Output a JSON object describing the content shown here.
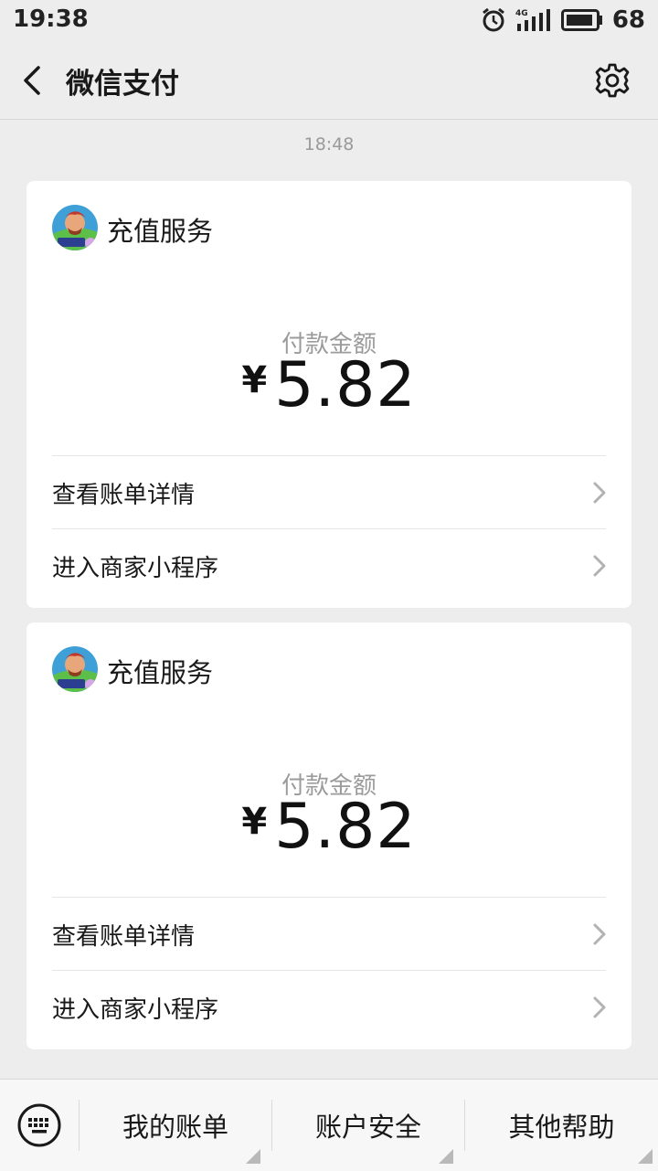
{
  "status_bar": {
    "time": "19:38",
    "network": "4G",
    "battery": "68"
  },
  "header": {
    "title": "微信支付"
  },
  "chat": {
    "timestamp": "18:48",
    "cards": [
      {
        "merchant": "充值服务",
        "amount_label": "付款金额",
        "currency": "¥",
        "amount": "5.82",
        "rows": [
          {
            "label": "查看账单详情"
          },
          {
            "label": "进入商家小程序"
          }
        ]
      },
      {
        "merchant": "充值服务",
        "amount_label": "付款金额",
        "currency": "¥",
        "amount": "5.82",
        "rows": [
          {
            "label": "查看账单详情"
          },
          {
            "label": "进入商家小程序"
          }
        ]
      }
    ]
  },
  "bottom_bar": {
    "tabs": [
      {
        "label": "我的账单"
      },
      {
        "label": "账户安全"
      },
      {
        "label": "其他帮助"
      }
    ]
  },
  "icons": [
    "back-icon",
    "gear-icon",
    "alarm-icon",
    "signal-icon",
    "battery-icon",
    "keyboard-icon",
    "chevron-right-icon"
  ],
  "colors": {
    "background": "#ededed",
    "card": "#ffffff",
    "muted_text": "#9b9b9b"
  }
}
